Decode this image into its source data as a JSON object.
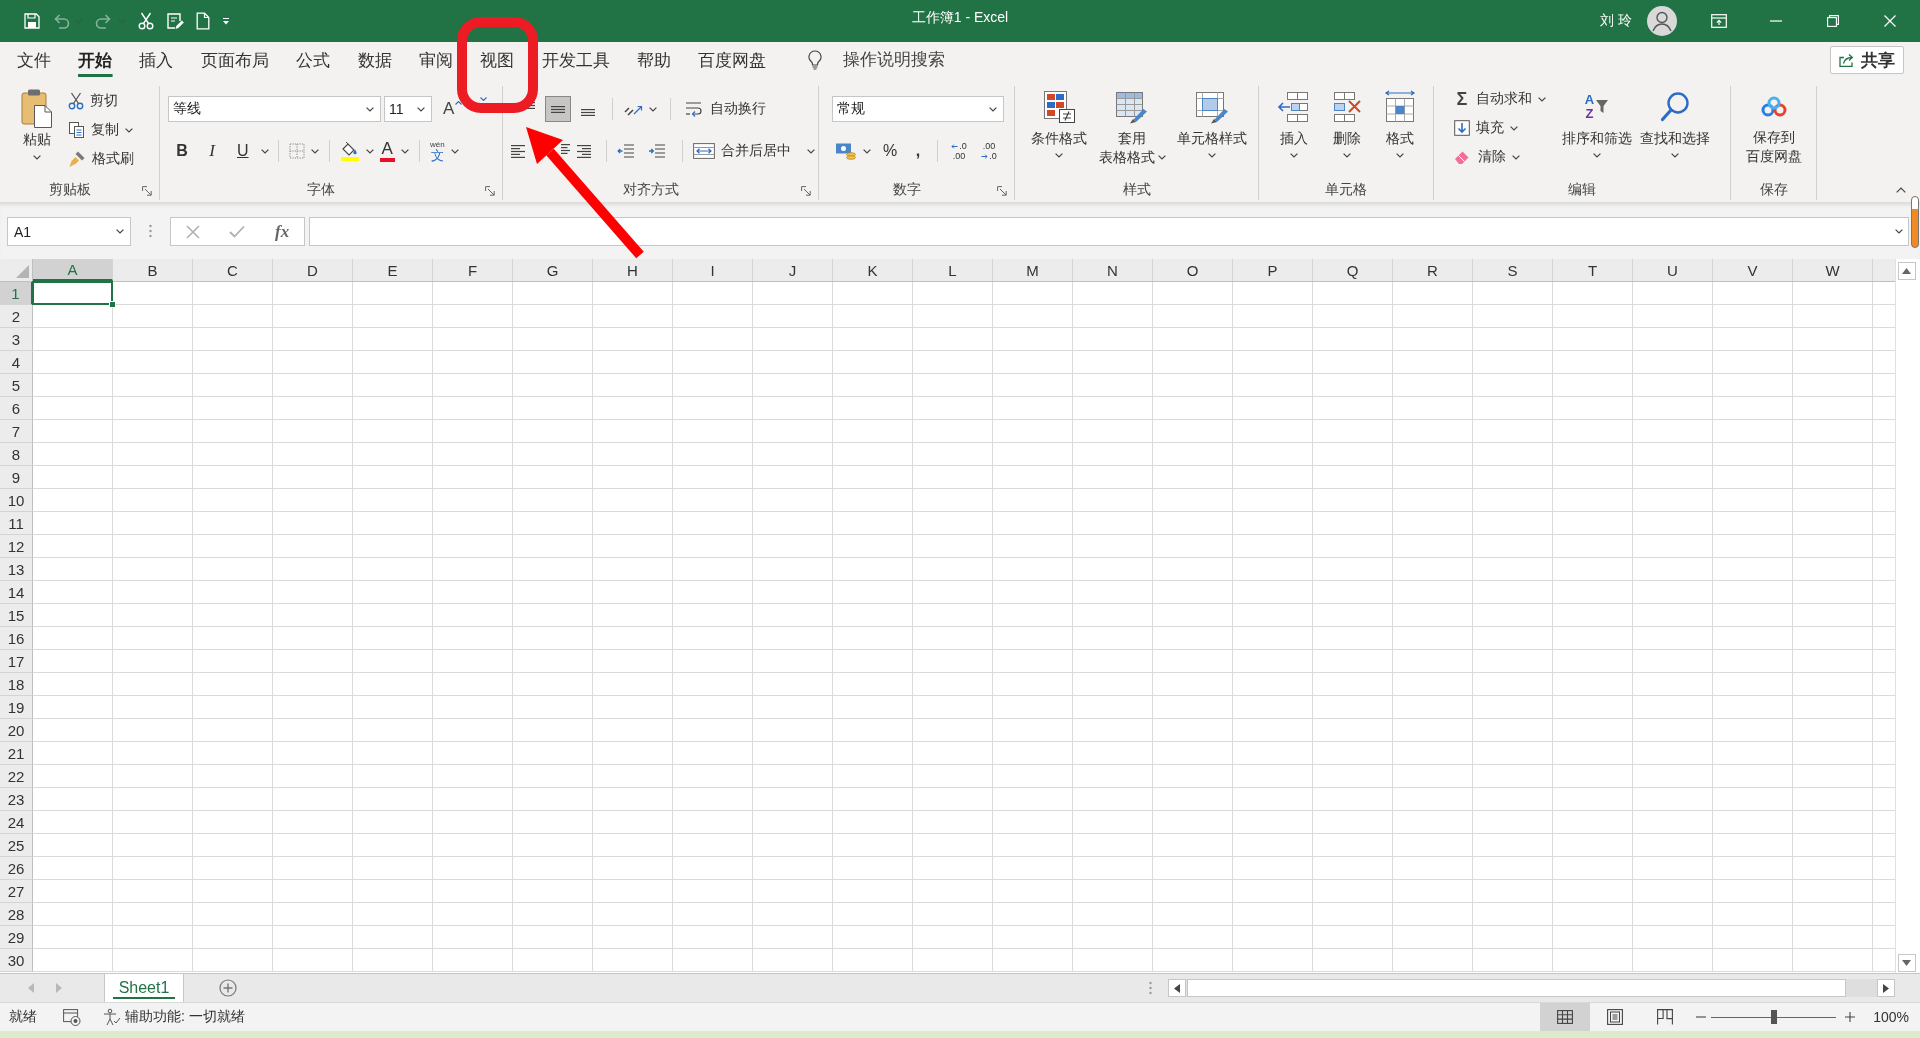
{
  "title_bar": {
    "quick_access": [
      {
        "kind": "save",
        "disabled": false
      },
      {
        "kind": "undo",
        "disabled": true
      },
      {
        "kind": "redo",
        "disabled": true
      },
      {
        "kind": "cut",
        "disabled": false
      },
      {
        "kind": "form",
        "disabled": false
      },
      {
        "kind": "new",
        "disabled": false
      },
      {
        "kind": "customize",
        "disabled": false
      }
    ],
    "title": "工作簿1 - Excel",
    "user": "刘 玲"
  },
  "tabs": [
    {
      "label": "文件",
      "selected": false,
      "circled": false
    },
    {
      "label": "开始",
      "selected": true,
      "circled": false
    },
    {
      "label": "插入",
      "selected": false,
      "circled": false
    },
    {
      "label": "页面布局",
      "selected": false,
      "circled": false
    },
    {
      "label": "公式",
      "selected": false,
      "circled": false
    },
    {
      "label": "数据",
      "selected": false,
      "circled": false
    },
    {
      "label": "审阅",
      "selected": false,
      "circled": false
    },
    {
      "label": "视图",
      "selected": false,
      "circled": true
    },
    {
      "label": "开发工具",
      "selected": false,
      "circled": false
    },
    {
      "label": "帮助",
      "selected": false,
      "circled": false
    },
    {
      "label": "百度网盘",
      "selected": false,
      "circled": false
    }
  ],
  "tell_me": {
    "placeholder": "操作说明搜索"
  },
  "share": {
    "label": "共享"
  },
  "ribbon": {
    "clipboard": {
      "label": "剪贴板",
      "paste": "粘贴",
      "commands": [
        {
          "kind": "cut",
          "label": "剪切"
        },
        {
          "kind": "copy",
          "label": "复制"
        },
        {
          "kind": "format_painter",
          "label": "格式刷"
        }
      ]
    },
    "font": {
      "label": "字体",
      "font_name": "等线",
      "font_size": "11",
      "grow": "A",
      "styles": [
        {
          "kind": "bold",
          "label": "B"
        },
        {
          "kind": "italic",
          "label": "I"
        },
        {
          "kind": "underline",
          "label": "U"
        }
      ],
      "font_color": "A",
      "phonetic": [
        "wén",
        "文"
      ]
    },
    "alignment": {
      "label": "对齐方式",
      "vertical": [
        {
          "kind": "top",
          "selected": false
        },
        {
          "kind": "middle",
          "selected": true
        },
        {
          "kind": "bottom",
          "selected": false
        }
      ],
      "horizontal": [
        {
          "kind": "left",
          "selected": false
        },
        {
          "kind": "center",
          "selected": false
        },
        {
          "kind": "right",
          "selected": false
        }
      ],
      "wrap_text": "自动换行",
      "merge": "合并后居中"
    },
    "number": {
      "label": "数字",
      "format": "常规",
      "percent": "%",
      "comma": ",",
      "decimals": [
        {
          "kind": "increase",
          "lines": [
            ".0",
            ".00"
          ]
        },
        {
          "kind": "decrease",
          "lines": [
            ".00",
            ".0"
          ]
        }
      ]
    },
    "styles": {
      "label": "样式",
      "commands": [
        {
          "kind": "conditional",
          "lines": [
            "条件格式"
          ]
        },
        {
          "kind": "table",
          "lines": [
            "套用",
            "表格格式"
          ]
        },
        {
          "kind": "cell_styles",
          "lines": [
            "单元格样式"
          ]
        }
      ]
    },
    "cells": {
      "label": "单元格",
      "commands": [
        {
          "kind": "insert",
          "label": "插入"
        },
        {
          "kind": "delete",
          "label": "删除"
        },
        {
          "kind": "format",
          "label": "格式"
        }
      ]
    },
    "editing": {
      "label": "编辑",
      "small": [
        {
          "kind": "autosum",
          "label": "自动求和",
          "glyph": "Σ"
        },
        {
          "kind": "fill",
          "label": "填充"
        },
        {
          "kind": "clear",
          "label": "清除"
        }
      ],
      "large": [
        {
          "kind": "sort",
          "label": "排序和筛选",
          "glyphs": [
            "A",
            "Z"
          ]
        },
        {
          "kind": "find",
          "label": "查找和选择"
        }
      ]
    },
    "save": {
      "label": "保存",
      "lines": [
        "保存到",
        "百度网盘"
      ]
    }
  },
  "formula_bar": {
    "name_box": "A1",
    "function": "fx"
  },
  "sheet": {
    "columns": [
      {
        "label": "A",
        "selected": true
      },
      {
        "label": "B",
        "selected": false
      },
      {
        "label": "C",
        "selected": false
      },
      {
        "label": "D",
        "selected": false
      },
      {
        "label": "E",
        "selected": false
      },
      {
        "label": "F",
        "selected": false
      },
      {
        "label": "G",
        "selected": false
      },
      {
        "label": "H",
        "selected": false
      },
      {
        "label": "I",
        "selected": false
      },
      {
        "label": "J",
        "selected": false
      },
      {
        "label": "K",
        "selected": false
      },
      {
        "label": "L",
        "selected": false
      },
      {
        "label": "M",
        "selected": false
      },
      {
        "label": "N",
        "selected": false
      },
      {
        "label": "O",
        "selected": false
      },
      {
        "label": "P",
        "selected": false
      },
      {
        "label": "Q",
        "selected": false
      },
      {
        "label": "R",
        "selected": false
      },
      {
        "label": "S",
        "selected": false
      },
      {
        "label": "T",
        "selected": false
      },
      {
        "label": "U",
        "selected": false
      },
      {
        "label": "V",
        "selected": false
      },
      {
        "label": "W",
        "selected": false
      }
    ],
    "rows": [
      {
        "label": "1",
        "selected": true
      },
      {
        "label": "2",
        "selected": false
      },
      {
        "label": "3",
        "selected": false
      },
      {
        "label": "4",
        "selected": false
      },
      {
        "label": "5",
        "selected": false
      },
      {
        "label": "6",
        "selected": false
      },
      {
        "label": "7",
        "selected": false
      },
      {
        "label": "8",
        "selected": false
      },
      {
        "label": "9",
        "selected": false
      },
      {
        "label": "10",
        "selected": false
      },
      {
        "label": "11",
        "selected": false
      },
      {
        "label": "12",
        "selected": false
      },
      {
        "label": "13",
        "selected": false
      },
      {
        "label": "14",
        "selected": false
      },
      {
        "label": "15",
        "selected": false
      },
      {
        "label": "16",
        "selected": false
      },
      {
        "label": "17",
        "selected": false
      },
      {
        "label": "18",
        "selected": false
      },
      {
        "label": "19",
        "selected": false
      },
      {
        "label": "20",
        "selected": false
      },
      {
        "label": "21",
        "selected": false
      },
      {
        "label": "22",
        "selected": false
      },
      {
        "label": "23",
        "selected": false
      },
      {
        "label": "24",
        "selected": false
      },
      {
        "label": "25",
        "selected": false
      },
      {
        "label": "26",
        "selected": false
      },
      {
        "label": "27",
        "selected": false
      },
      {
        "label": "28",
        "selected": false
      },
      {
        "label": "29",
        "selected": false
      },
      {
        "label": "30",
        "selected": false
      }
    ]
  },
  "sheet_tabs": [
    {
      "label": "Sheet1",
      "selected": true
    }
  ],
  "status_bar": {
    "mode": "就绪",
    "accessibility": "辅助功能: 一切就绪",
    "views": [
      {
        "kind": "normal",
        "selected": true
      },
      {
        "kind": "page_layout",
        "selected": false
      },
      {
        "kind": "page_break",
        "selected": false
      }
    ],
    "zoom": {
      "level": 0.5,
      "reading": "100%"
    }
  },
  "annotations": [
    {
      "kind": "arrow"
    }
  ]
}
